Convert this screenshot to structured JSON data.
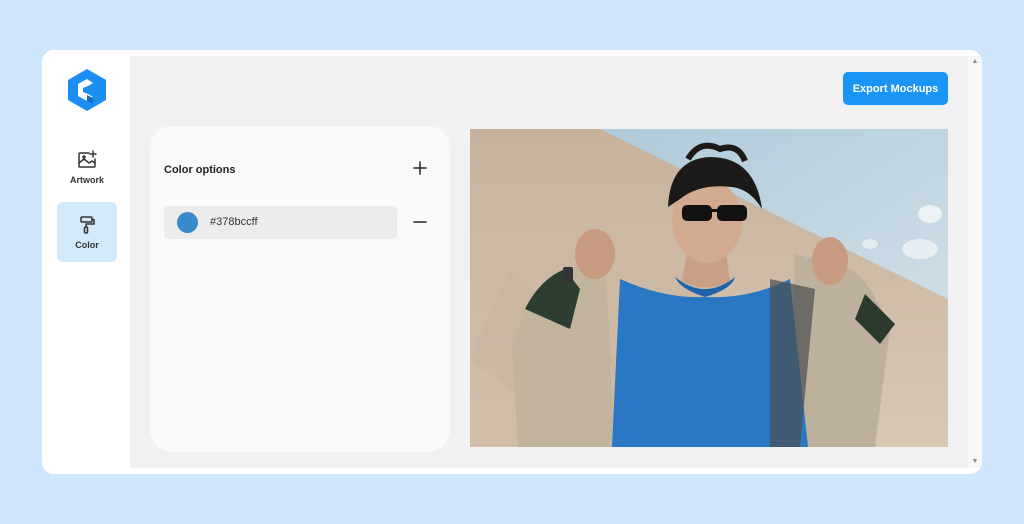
{
  "sidebar": {
    "items": [
      {
        "label": "Artwork",
        "icon": "image-plus-icon",
        "active": false
      },
      {
        "label": "Color",
        "icon": "paint-roller-icon",
        "active": true
      }
    ]
  },
  "header": {
    "export_label": "Export Mockups"
  },
  "color_panel": {
    "title": "Color options",
    "colors": [
      {
        "hex": "#378bccff",
        "swatch": "#378bcc"
      }
    ]
  },
  "theme": {
    "accent": "#1a95f5",
    "background": "#cfe5fb",
    "logo": "#1a8ef2",
    "active_nav": "#d2e8fb"
  },
  "preview": {
    "subject": "man-in-blue-tshirt-photo"
  }
}
